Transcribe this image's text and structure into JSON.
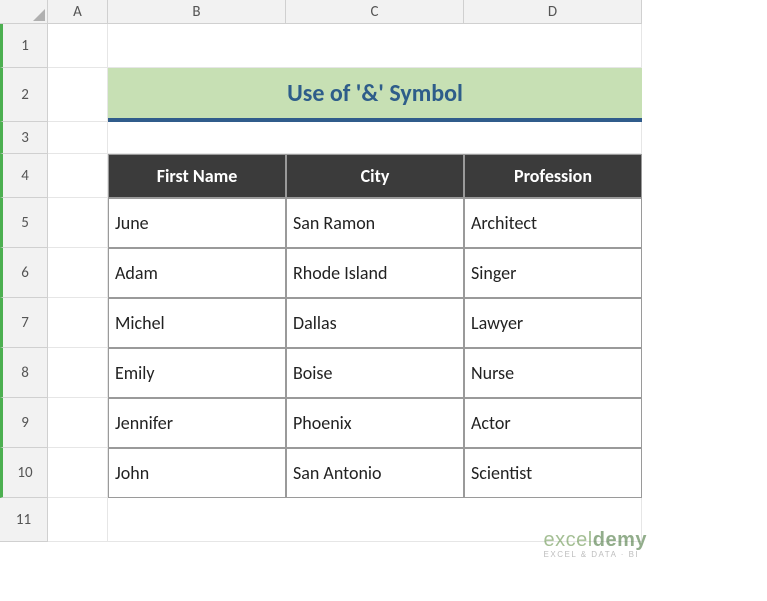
{
  "columns": [
    "A",
    "B",
    "C",
    "D"
  ],
  "rows": [
    "1",
    "2",
    "3",
    "4",
    "5",
    "6",
    "7",
    "8",
    "9",
    "10",
    "11"
  ],
  "title": "Use of '&' Symbol",
  "table": {
    "headers": [
      "First Name",
      "City",
      "Profession"
    ],
    "data": [
      [
        "June",
        "San Ramon",
        "Architect"
      ],
      [
        "Adam",
        "Rhode Island",
        "Singer"
      ],
      [
        "Michel",
        "Dallas",
        "Lawyer"
      ],
      [
        "Emily",
        "Boise",
        "Nurse"
      ],
      [
        "Jennifer",
        "Phoenix",
        "Actor"
      ],
      [
        "John",
        "San Antonio",
        "Scientist"
      ]
    ]
  },
  "watermark": {
    "main_part1": "excel",
    "main_part2": "demy",
    "sub": "EXCEL & DATA · BI"
  }
}
